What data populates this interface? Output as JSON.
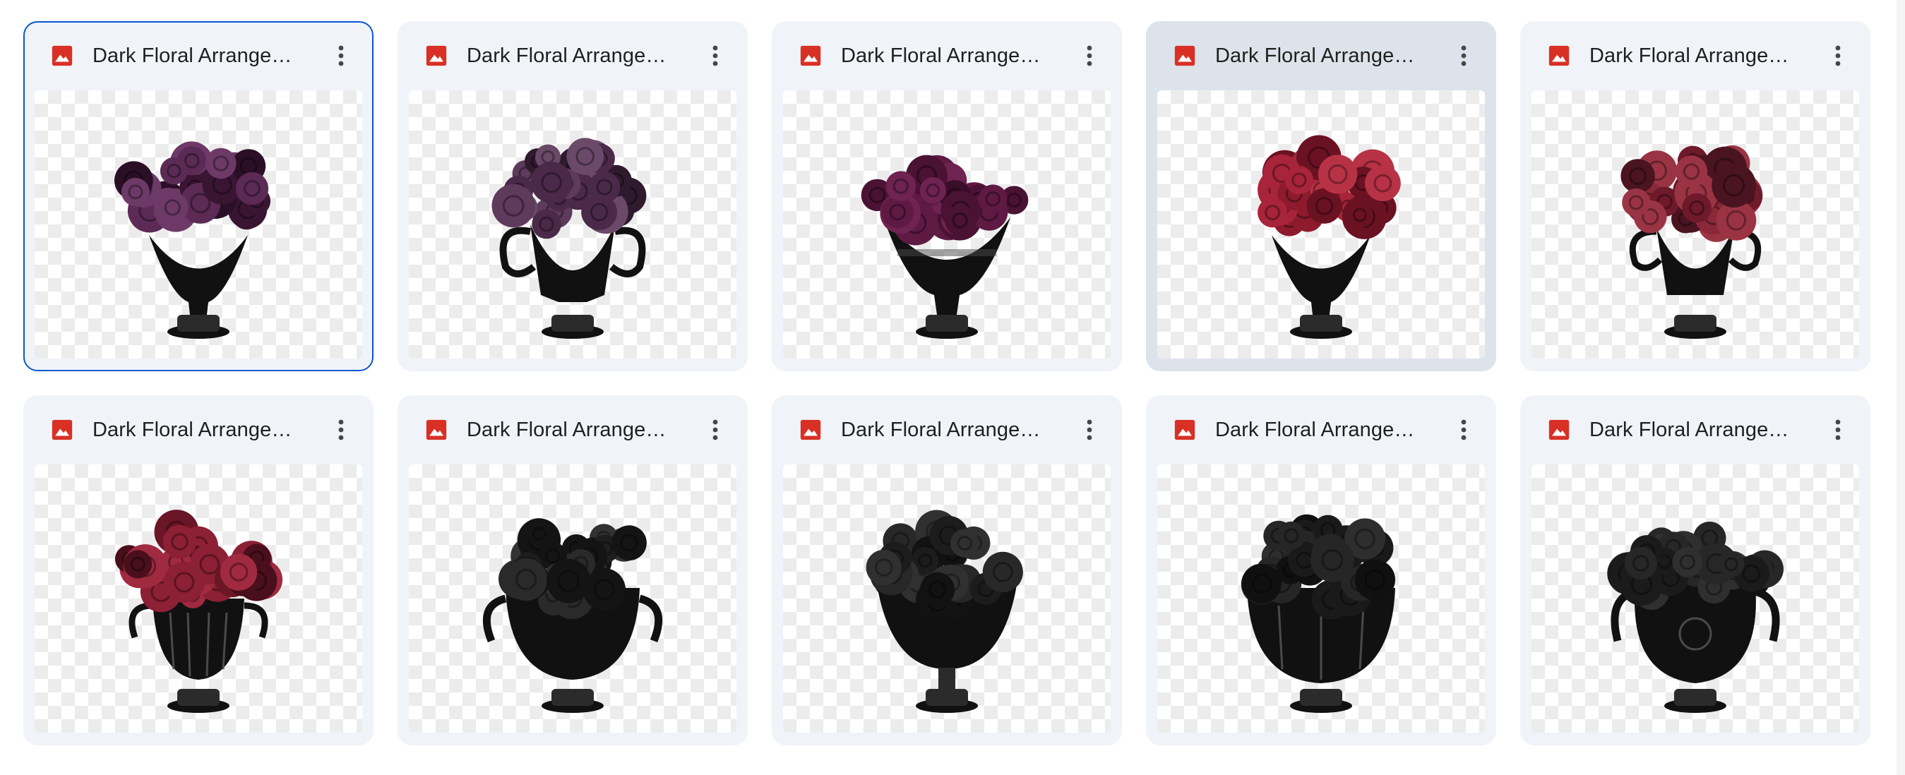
{
  "files": [
    {
      "name": "Dark Floral Arrangem...",
      "icon": "image-file-icon",
      "state": "selected",
      "art": {
        "flowers": [
          "#3a1533",
          "#5b2a55",
          "#6d3a67",
          "#2a0f26"
        ],
        "vase": "urn-tall"
      }
    },
    {
      "name": "Dark Floral Arrangem...",
      "icon": "image-file-icon",
      "state": "normal",
      "art": {
        "flowers": [
          "#4a2a48",
          "#5e3a5c",
          "#2f1a2e",
          "#6a4a68"
        ],
        "vase": "urn-handles"
      }
    },
    {
      "name": "Dark Floral Arrangem...",
      "icon": "image-file-icon",
      "state": "normal",
      "art": {
        "flowers": [
          "#4a1233",
          "#5f1a44",
          "#3a0e2a",
          "#6e2350"
        ],
        "vase": "urn-wide"
      }
    },
    {
      "name": "Dark Floral Arrangem...",
      "icon": "image-file-icon",
      "state": "hovered",
      "art": {
        "flowers": [
          "#8e1a2e",
          "#a8243a",
          "#6a1222",
          "#b83245"
        ],
        "vase": "urn-tall"
      }
    },
    {
      "name": "Dark Floral Arrangem...",
      "icon": "image-file-icon",
      "state": "normal",
      "art": {
        "flowers": [
          "#6e1a2a",
          "#8a2838",
          "#4a1420",
          "#9a3444"
        ],
        "vase": "urn-handles-small"
      }
    },
    {
      "name": "Dark Floral Arrangem...",
      "icon": "image-file-icon",
      "state": "normal",
      "art": {
        "flowers": [
          "#6a1626",
          "#8c2034",
          "#4a0f1c",
          "#a02a40"
        ],
        "vase": "urn-fluted"
      }
    },
    {
      "name": "Dark Floral Arrangem...",
      "icon": "image-file-icon",
      "state": "normal",
      "art": {
        "flowers": [
          "#1e1e1e",
          "#2a2a2a",
          "#141414",
          "#333333"
        ],
        "vase": "bowl"
      }
    },
    {
      "name": "Dark Floral Arrangem...",
      "icon": "image-file-icon",
      "state": "normal",
      "art": {
        "flowers": [
          "#1c1c1c",
          "#282828",
          "#121212",
          "#303030"
        ],
        "vase": "goblet"
      }
    },
    {
      "name": "Dark Floral Arrangem...",
      "icon": "image-file-icon",
      "state": "normal",
      "art": {
        "flowers": [
          "#1a1a1a",
          "#262626",
          "#101010",
          "#2e2e2e"
        ],
        "vase": "bowl-wide"
      }
    },
    {
      "name": "Dark Floral Arrangem...",
      "icon": "image-file-icon",
      "state": "normal",
      "art": {
        "flowers": [
          "#1b1b1b",
          "#272727",
          "#111111",
          "#2f2f2f"
        ],
        "vase": "urn-ornate"
      }
    }
  ],
  "colors": {
    "icon_red": "#d93025",
    "selected_border": "#0b57d0",
    "card_bg": "#f0f4f9",
    "hover_bg": "#dde3ea"
  }
}
